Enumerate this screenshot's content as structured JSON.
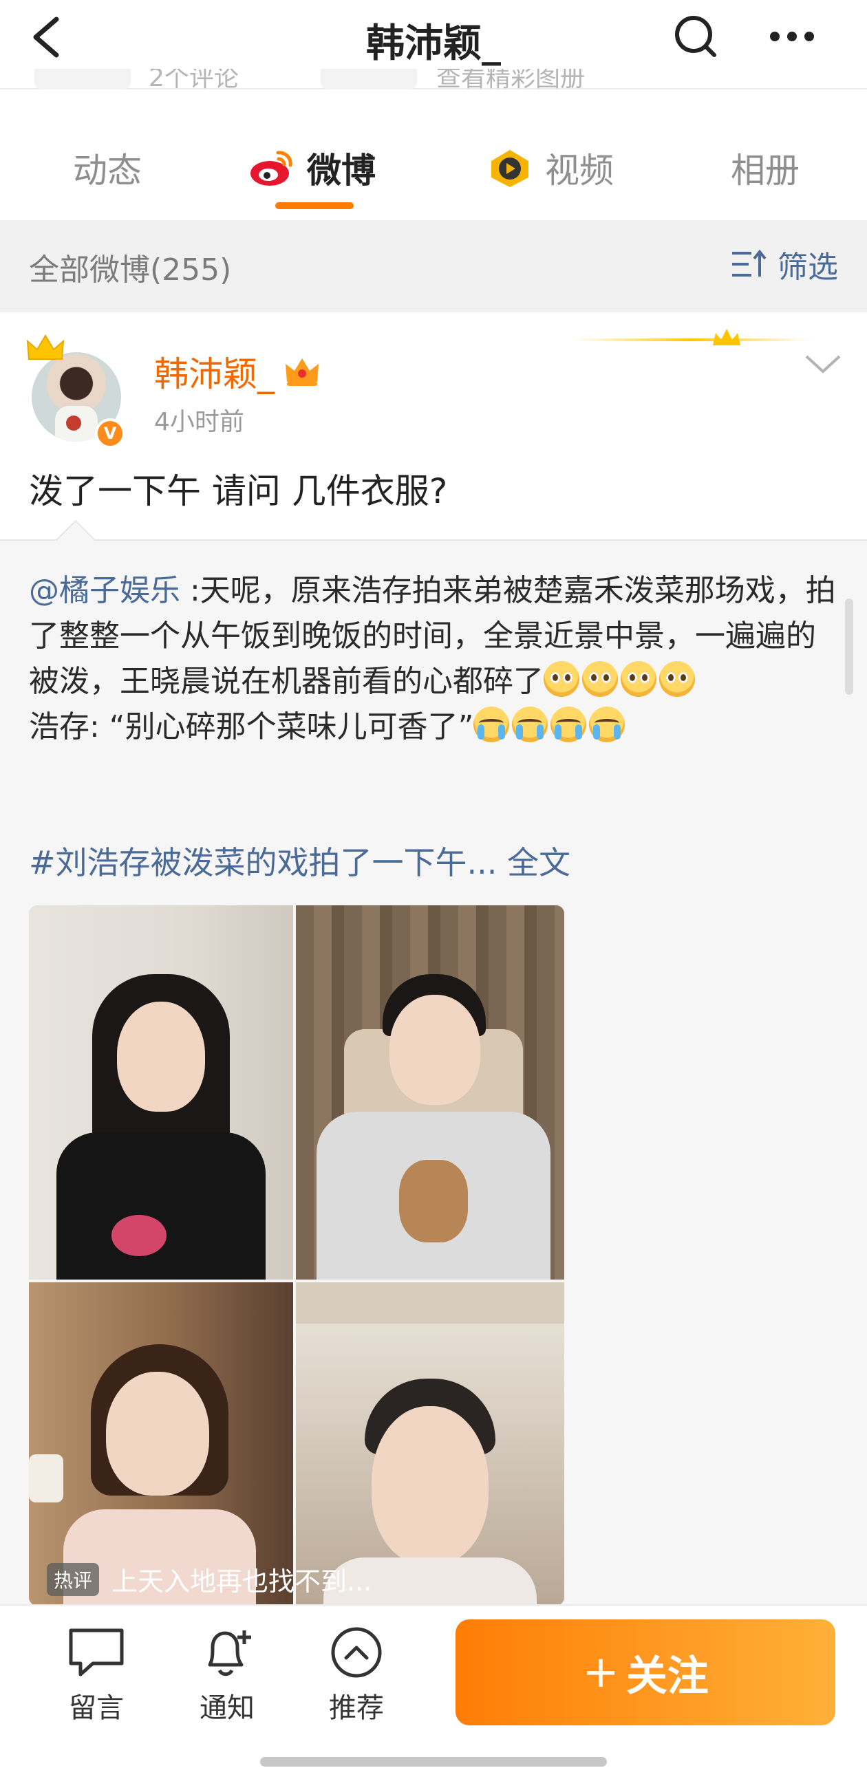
{
  "topbar": {
    "title": "韩沛颖_",
    "cut_left": "2个评论",
    "cut_right": "查看精彩图册"
  },
  "tabs": [
    {
      "label": "动态",
      "active": false
    },
    {
      "label": "微博",
      "active": true
    },
    {
      "label": "视频",
      "active": false
    },
    {
      "label": "相册",
      "active": false
    }
  ],
  "filter": {
    "count_label": "全部微博(255)",
    "filter_label": "筛选"
  },
  "post": {
    "author": "韩沛颖_",
    "time": "4小时前",
    "text": "泼了一下午 请问 几件衣服?",
    "verify_mark": "V"
  },
  "repost": {
    "mention": "@橘子娱乐",
    "text_1": " :天呢，原来浩存拍来弟被楚嘉禾泼菜那场戏，拍了整整一个从午饭到晚饭的时间，全景近景中景，一遍遍的被泼，王晓晨说在机器前看的心都碎了",
    "text_2": "浩存: “别心碎那个菜味儿可香了”",
    "hashtag": "#刘浩存被泼菜的戏拍了一下午...",
    "full_text_link": "全文",
    "hot_tag": "热评",
    "hot_comment": "上天入地再也找不到..."
  },
  "bottom_bar": {
    "comment_label": "留言",
    "notify_label": "通知",
    "recommend_label": "推荐",
    "follow_label": "关注",
    "follow_plus": "+"
  },
  "colors": {
    "accent": "#ff7a00",
    "link": "#4a6a98",
    "author": "#f06800"
  },
  "icons": [
    "back-icon",
    "search-icon",
    "more-icon",
    "weibo-logo-icon",
    "video-play-icon",
    "filter-icon",
    "crown-icon",
    "vip-crown-icon",
    "chevron-down-icon",
    "comment-icon",
    "bell-plus-icon",
    "chevron-up-circle-icon"
  ]
}
